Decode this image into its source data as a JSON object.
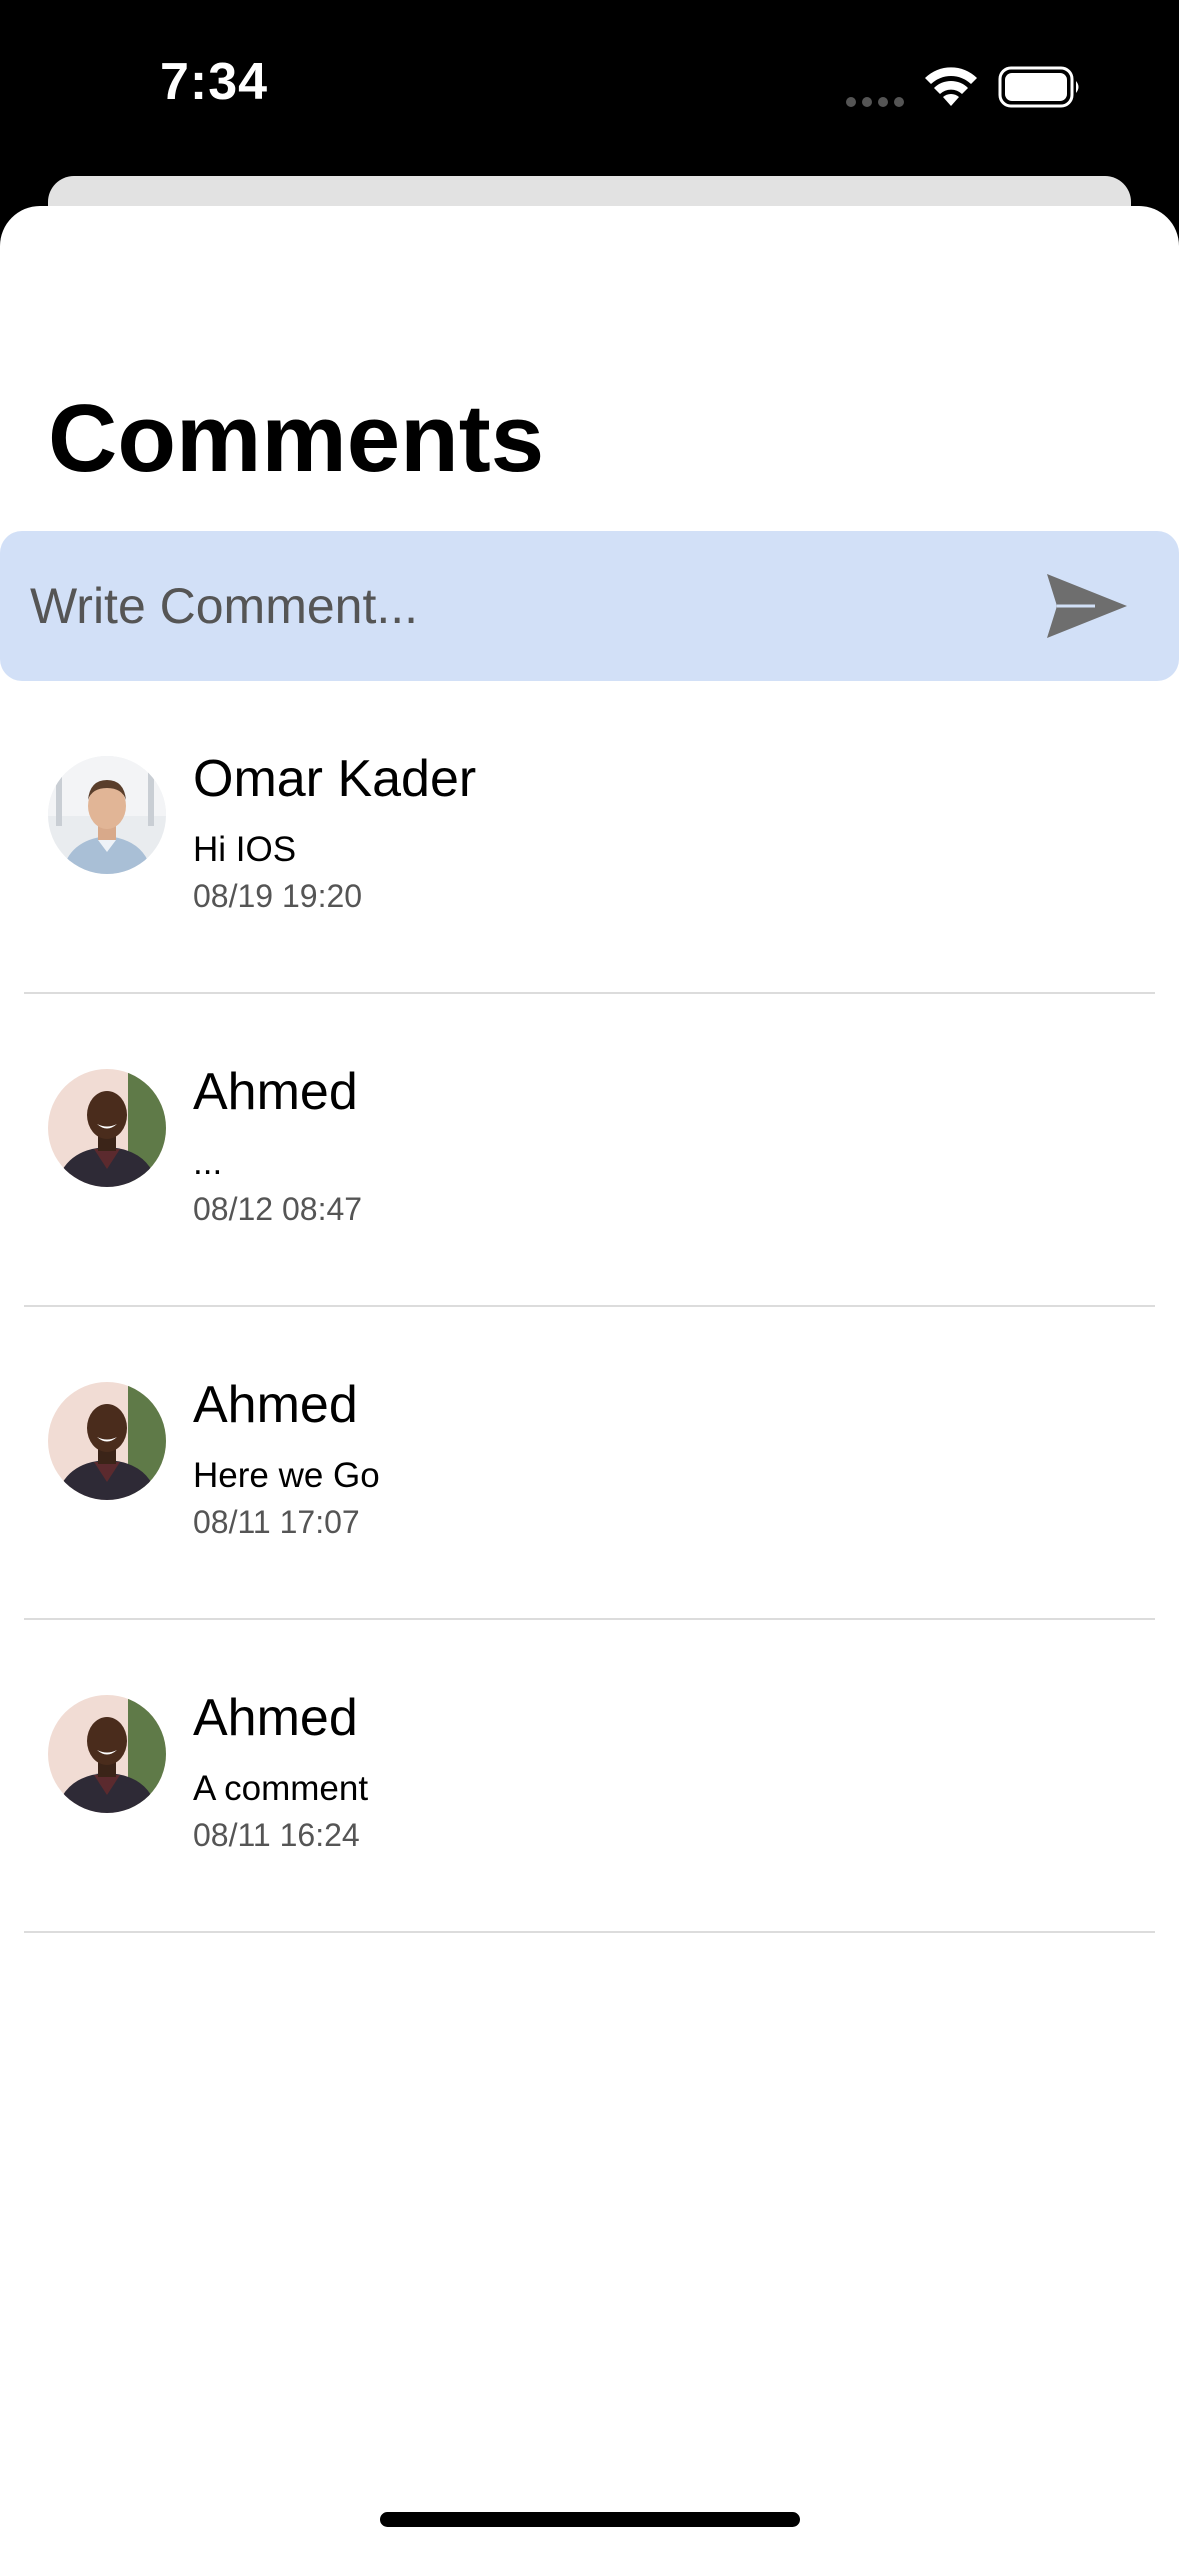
{
  "status_bar": {
    "time": "7:34"
  },
  "header": {
    "title": "Comments"
  },
  "composer": {
    "placeholder": "Write Comment...",
    "send_icon": "send-icon"
  },
  "comments": [
    {
      "name": "Omar Kader",
      "text": "Hi IOS",
      "date": "08/19 19:20",
      "avatar": "user-avatar-omar"
    },
    {
      "name": "Ahmed",
      "text": "...",
      "date": "08/12 08:47",
      "avatar": "user-avatar-ahmed"
    },
    {
      "name": "Ahmed",
      "text": "Here we Go",
      "date": "08/11 17:07",
      "avatar": "user-avatar-ahmed"
    },
    {
      "name": "Ahmed",
      "text": "A comment",
      "date": "08/11 16:24",
      "avatar": "user-avatar-ahmed"
    }
  ],
  "colors": {
    "composer_bg": "#d2e0f7",
    "send_icon": "#6e6e6e",
    "divider": "#dcdcdc"
  }
}
